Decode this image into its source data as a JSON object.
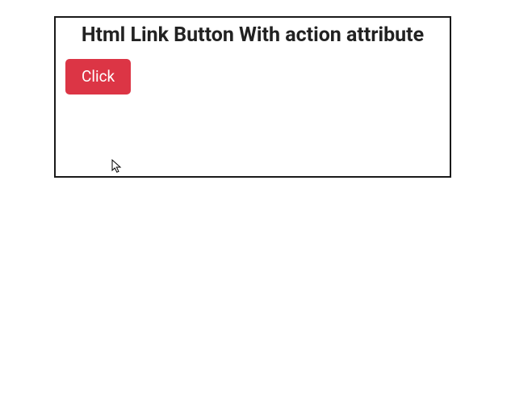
{
  "card": {
    "title": "Html Link Button With action attribute",
    "button_label": "Click"
  },
  "colors": {
    "button_bg": "#dc3545",
    "button_fg": "#ffffff",
    "border": "#1a1a1a"
  }
}
